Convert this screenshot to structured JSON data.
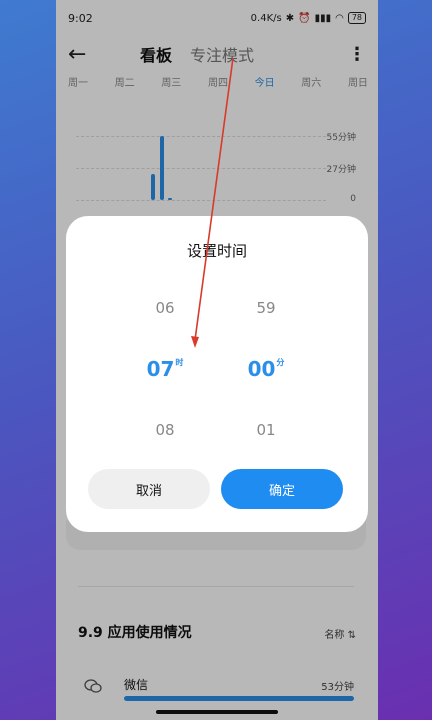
{
  "status_bar": {
    "time": "9:02",
    "network_speed": "0.4K/s",
    "battery": "78"
  },
  "header": {
    "tab_board": "看板",
    "tab_focus": "专注模式"
  },
  "weekdays": [
    "周一",
    "周二",
    "周三",
    "周四",
    "今日",
    "周六",
    "周日"
  ],
  "chart_labels": {
    "top": "55分钟",
    "mid": "27分钟",
    "zero": "0"
  },
  "dialog": {
    "title": "设置时间",
    "hour_prev": "06",
    "hour_current": "07",
    "hour_next": "08",
    "hour_unit": "时",
    "minute_prev": "59",
    "minute_current": "00",
    "minute_next": "01",
    "minute_unit": "分",
    "cancel_label": "取消",
    "confirm_label": "确定"
  },
  "usage": {
    "title": "9.9 应用使用情况",
    "sort_label": "名称 ⇅",
    "apps": [
      {
        "name": "微信",
        "time": "53分钟"
      }
    ]
  },
  "colors": {
    "accent": "#2b8ee8",
    "confirm_button": "#1e8cf0",
    "annotation_arrow": "#d93a2b"
  }
}
